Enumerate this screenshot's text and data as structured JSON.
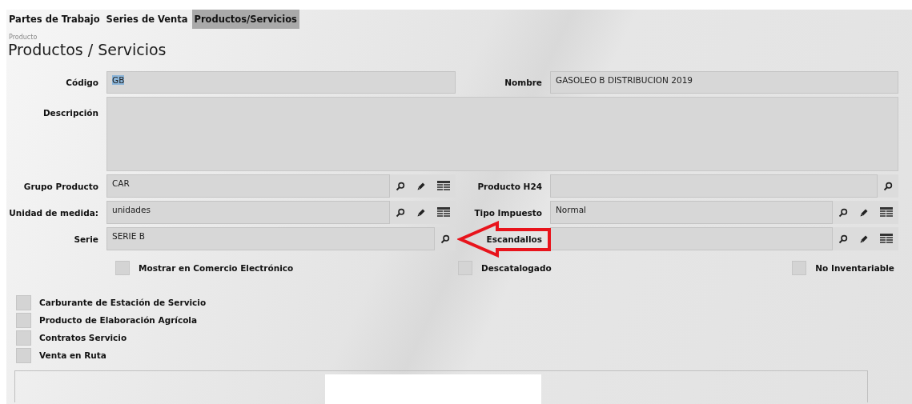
{
  "tabs": [
    {
      "label": "Partes de Trabajo",
      "selected": false
    },
    {
      "label": "Series de Venta",
      "selected": false
    },
    {
      "label": "Productos/Servicios",
      "selected": true
    }
  ],
  "header": {
    "caption": "Producto",
    "title": "Productos / Servicios"
  },
  "rows": [
    [
      {
        "kind": "text",
        "label": "Código",
        "value": "GB",
        "highlighted": true
      },
      {
        "kind": "text",
        "label": "Nombre",
        "value": "GASOLEO B DISTRIBUCION 2019",
        "highlighted": false
      }
    ],
    [
      {
        "kind": "multiline",
        "label": "Descripción"
      }
    ],
    [
      {
        "kind": "lookup",
        "label": "Grupo Producto",
        "value": "CAR",
        "actions": [
          {
            "kind": "search"
          },
          {
            "kind": "edit"
          },
          {
            "kind": "grid"
          }
        ]
      },
      {
        "kind": "lookup",
        "label": "Producto H24",
        "actions": [
          {
            "kind": "search"
          }
        ]
      }
    ],
    [
      {
        "kind": "lookup",
        "label": "Unidad de medida:",
        "value": "unidades",
        "actions": [
          {
            "kind": "search"
          },
          {
            "kind": "edit"
          },
          {
            "kind": "grid"
          }
        ]
      },
      {
        "kind": "lookup",
        "label": "Tipo Impuesto",
        "value": "Normal",
        "actions": [
          {
            "kind": "search"
          },
          {
            "kind": "edit"
          },
          {
            "kind": "grid"
          }
        ]
      }
    ],
    [
      {
        "kind": "lookup",
        "label": "Serie",
        "value": "SERIE B",
        "actions": [
          {
            "kind": "search"
          }
        ]
      },
      {
        "kind": "lookup",
        "label": "Escandallos",
        "actions": [
          {
            "kind": "search"
          },
          {
            "kind": "edit"
          },
          {
            "kind": "grid"
          }
        ],
        "annotated": true
      }
    ]
  ],
  "options": [
    {
      "label": "Mostrar en Comercio Electrónico",
      "checked": false
    },
    {
      "label": "Descatalogado",
      "checked": false
    },
    {
      "label": "No Inventariable",
      "checked": false
    }
  ],
  "flags": [
    {
      "label": "Carburante de Estación de Servicio",
      "checked": false
    },
    {
      "label": "Producto de Elaboración Agrícola",
      "checked": false
    },
    {
      "label": "Contratos Servicio",
      "checked": false
    },
    {
      "label": "Venta en Ruta",
      "checked": false
    }
  ]
}
